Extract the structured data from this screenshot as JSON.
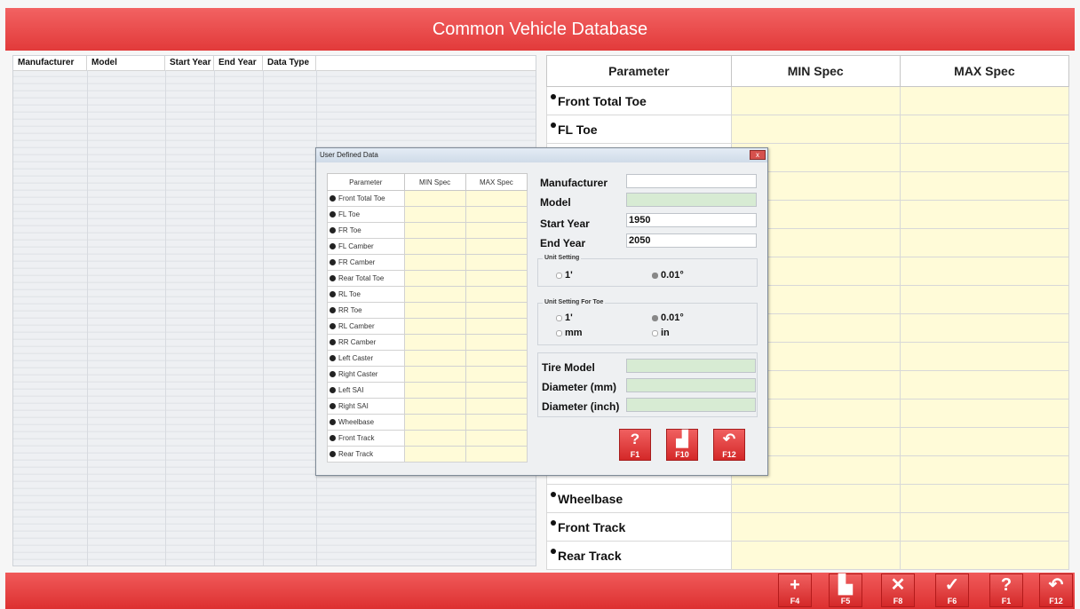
{
  "window": {
    "title": "Common Vehicle Database"
  },
  "left_list": {
    "columns": [
      "Manufacturer",
      "Model",
      "Start Year",
      "End Year",
      "Data Type"
    ]
  },
  "spec_table": {
    "headers": [
      "Parameter",
      "MIN Spec",
      "MAX Spec"
    ],
    "visible_top": [
      "Front Total Toe",
      "FL Toe",
      ""
    ],
    "visible_bottom": [
      "Wheelbase",
      "Front Track",
      "Rear Track"
    ]
  },
  "dialog": {
    "title": "User Defined Data",
    "close_label": "x",
    "table_headers": [
      "Parameter",
      "MIN Spec",
      "MAX Spec"
    ],
    "parameters": [
      "Front Total Toe",
      "FL Toe",
      "FR Toe",
      "FL Camber",
      "FR Camber",
      "Rear Total Toe",
      "RL Toe",
      "RR Toe",
      "RL Camber",
      "RR Camber",
      "Left Caster",
      "Right Caster",
      "Left SAI",
      "Right SAI",
      "Wheelbase",
      "Front Track",
      "Rear Track"
    ],
    "fields": {
      "manufacturer_label": "Manufacturer",
      "manufacturer_value": "",
      "model_label": "Model",
      "model_value": "",
      "start_year_label": "Start Year",
      "start_year_value": "1950",
      "end_year_label": "End Year",
      "end_year_value": "2050"
    },
    "unit_setting": {
      "legend": "Unit Setting",
      "options": [
        "1'",
        "0.01°"
      ],
      "selected": "0.01°"
    },
    "unit_setting_toe": {
      "legend": "Unit Setting For Toe",
      "options": [
        "1'",
        "0.01°",
        "mm",
        "in"
      ],
      "selected": "0.01°"
    },
    "tire": {
      "tire_model_label": "Tire Model",
      "tire_model_value": "",
      "diameter_mm_label": "Diameter (mm)",
      "diameter_mm_value": "",
      "diameter_inch_label": "Diameter (inch)",
      "diameter_inch_value": ""
    },
    "buttons": [
      {
        "key": "F1",
        "icon": "help-icon",
        "glyph": "?"
      },
      {
        "key": "F10",
        "icon": "save-icon",
        "glyph": "▟"
      },
      {
        "key": "F12",
        "icon": "return-icon",
        "glyph": "↶"
      }
    ]
  },
  "toolbar": [
    {
      "key": "F4",
      "icon": "add-icon",
      "glyph": "+"
    },
    {
      "key": "F5",
      "icon": "add-document-icon",
      "glyph": "▙"
    },
    {
      "key": "F8",
      "icon": "delete-icon",
      "glyph": "✕"
    },
    {
      "key": "F6",
      "icon": "edit-icon",
      "glyph": "✓"
    },
    {
      "key": "F1",
      "icon": "help-icon",
      "glyph": "?"
    },
    {
      "key": "F12",
      "icon": "return-icon",
      "glyph": "↶"
    }
  ],
  "colors": {
    "accent_red": "#e23a3a",
    "spec_cell_yellow": "#fffbd8",
    "input_green": "#d7ebd3"
  }
}
